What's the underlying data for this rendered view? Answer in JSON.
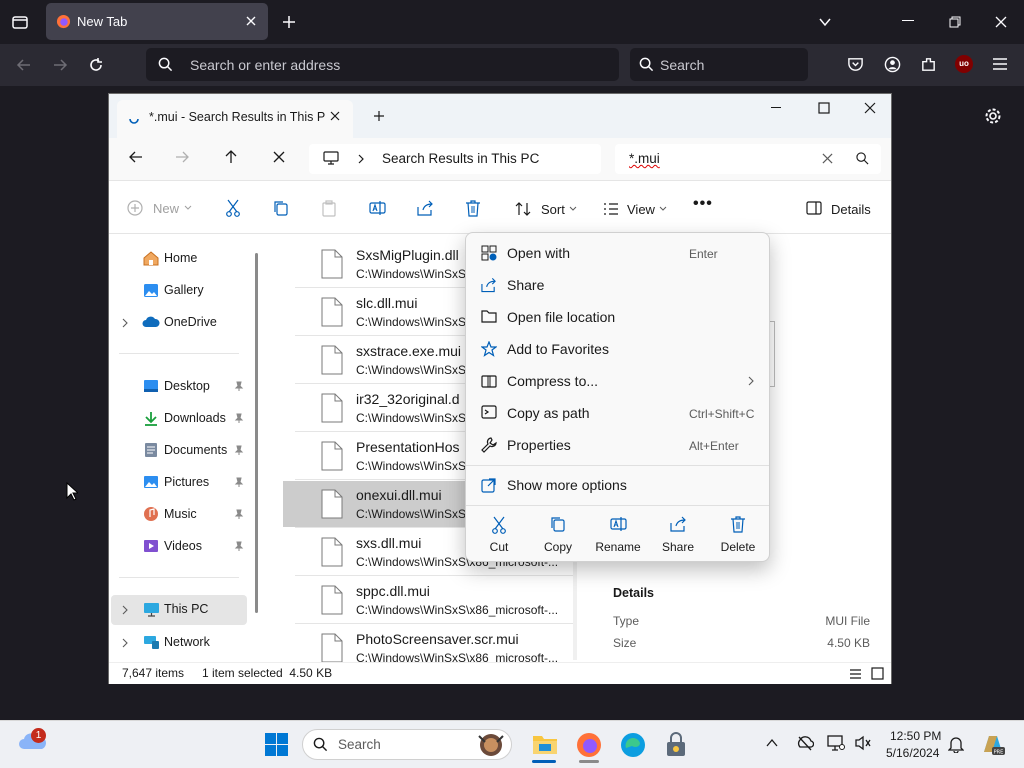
{
  "firefox": {
    "tab_title": "New Tab",
    "url_placeholder": "Search or enter address",
    "search_placeholder": "Search",
    "ublock_badge": "uo"
  },
  "explorer": {
    "tab_title": "*.mui - Search Results in This P",
    "breadcrumb": "Search Results in This PC",
    "search_query": "*.mui",
    "toolbar": {
      "new": "New",
      "sort": "Sort",
      "view": "View",
      "more": "•••",
      "details": "Details"
    },
    "nav": {
      "home": "Home",
      "gallery": "Gallery",
      "onedrive": "OneDrive",
      "desktop": "Desktop",
      "downloads": "Downloads",
      "documents": "Documents",
      "pictures": "Pictures",
      "music": "Music",
      "videos": "Videos",
      "this_pc": "This PC",
      "network": "Network"
    },
    "files": [
      {
        "name": "SxsMigPlugin.dll",
        "path": "C:\\Windows\\WinSxS\\"
      },
      {
        "name": "slc.dll.mui",
        "path": "C:\\Windows\\WinSxS\\"
      },
      {
        "name": "sxstrace.exe.mui",
        "path": "C:\\Windows\\WinSxS\\"
      },
      {
        "name": "ir32_32original.d",
        "path": "C:\\Windows\\WinSxS\\"
      },
      {
        "name": "PresentationHos",
        "path": "C:\\Windows\\WinSxS\\"
      },
      {
        "name": "onexui.dll.mui",
        "path": "C:\\Windows\\WinSxS\\"
      },
      {
        "name": "sxs.dll.mui",
        "path": "C:\\Windows\\WinSxS\\x86_microsoft-..."
      },
      {
        "name": "sppc.dll.mui",
        "path": "C:\\Windows\\WinSxS\\x86_microsoft-..."
      },
      {
        "name": "PhotoScreensaver.scr.mui",
        "path": "C:\\Windows\\WinSxS\\x86_microsoft-..."
      }
    ],
    "details": {
      "heading": "Details",
      "rows": [
        {
          "label": "Type",
          "value": "MUI File"
        },
        {
          "label": "Size",
          "value": "4.50 KB"
        }
      ]
    },
    "status": {
      "items": "7,647 items",
      "selected": "1 item selected  4.50 KB"
    }
  },
  "context_menu": {
    "items": [
      {
        "label": "Open with",
        "shortcut": "Enter"
      },
      {
        "label": "Share",
        "shortcut": ""
      },
      {
        "label": "Open file location",
        "shortcut": ""
      },
      {
        "label": "Add to Favorites",
        "shortcut": ""
      },
      {
        "label": "Compress to...",
        "shortcut": ""
      },
      {
        "label": "Copy as path",
        "shortcut": "Ctrl+Shift+C"
      },
      {
        "label": "Properties",
        "shortcut": "Alt+Enter"
      }
    ],
    "more_options": "Show more options",
    "actions": [
      "Cut",
      "Copy",
      "Rename",
      "Share",
      "Delete"
    ]
  },
  "taskbar": {
    "search_placeholder": "Search",
    "time": "12:50 PM",
    "date": "5/16/2024",
    "weather_badge": "1"
  },
  "colors": {
    "accent": "#005fb8",
    "firefox_bg": "#1c1b22",
    "firefox_toolbar": "#2b2a33",
    "selection": "#cccccc"
  }
}
